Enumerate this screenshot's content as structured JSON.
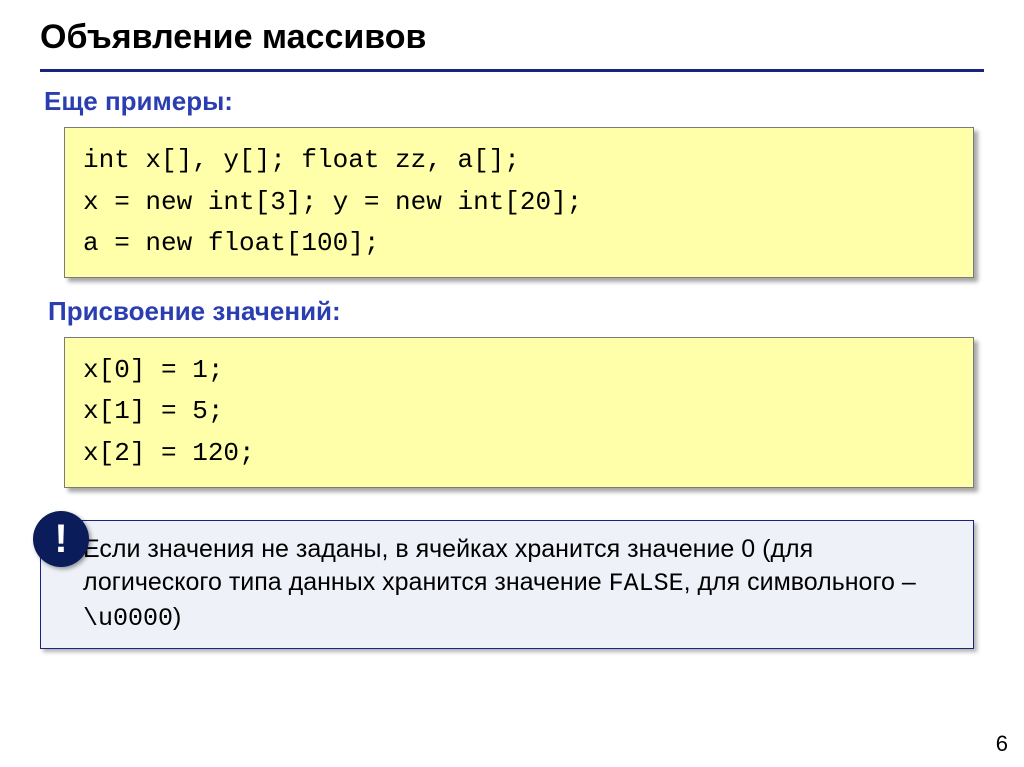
{
  "title": "Объявление массивов",
  "section1": {
    "heading": "Еще примеры:",
    "code": "int x[], y[]; float zz, a[];\nx = new int[3]; y = new int[20];\na = new float[100];"
  },
  "section2": {
    "heading": "Присвоение значений:",
    "code": "x[0] = 1;\nx[1] = 5;\nx[2] = 120;"
  },
  "note": {
    "bang": "!",
    "part1": "Если значения не заданы, в ячейках хранится значение 0 (для логического типа данных хранится значение ",
    "mono1": "FALSE",
    "part2": ", для символьного – ",
    "mono2": "\\u0000",
    "part3": ")"
  },
  "page_number": "6"
}
